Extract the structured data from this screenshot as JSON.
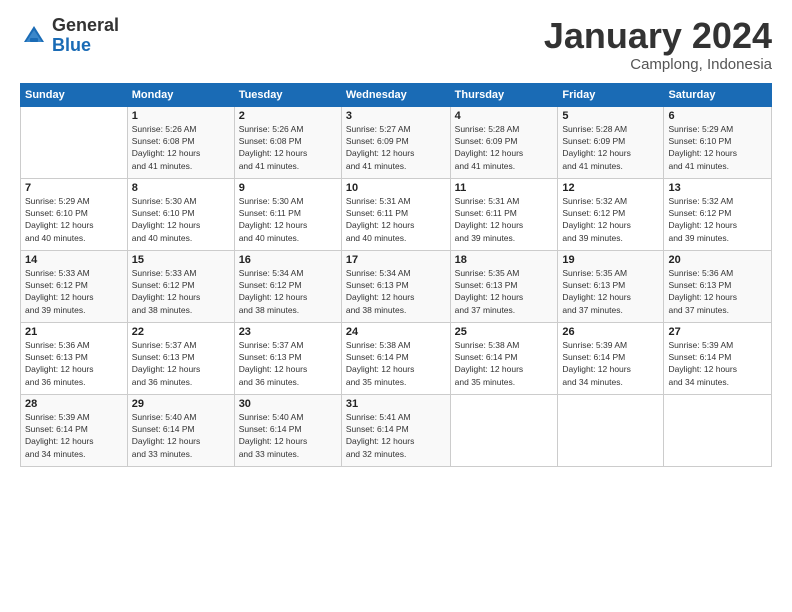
{
  "logo": {
    "general": "General",
    "blue": "Blue"
  },
  "header": {
    "month": "January 2024",
    "location": "Camplong, Indonesia"
  },
  "weekdays": [
    "Sunday",
    "Monday",
    "Tuesday",
    "Wednesday",
    "Thursday",
    "Friday",
    "Saturday"
  ],
  "weeks": [
    [
      {
        "day": "",
        "sunrise": "",
        "sunset": "",
        "daylight": ""
      },
      {
        "day": "1",
        "sunrise": "5:26 AM",
        "sunset": "6:08 PM",
        "daylight": "12 hours and 41 minutes."
      },
      {
        "day": "2",
        "sunrise": "5:26 AM",
        "sunset": "6:08 PM",
        "daylight": "12 hours and 41 minutes."
      },
      {
        "day": "3",
        "sunrise": "5:27 AM",
        "sunset": "6:09 PM",
        "daylight": "12 hours and 41 minutes."
      },
      {
        "day": "4",
        "sunrise": "5:28 AM",
        "sunset": "6:09 PM",
        "daylight": "12 hours and 41 minutes."
      },
      {
        "day": "5",
        "sunrise": "5:28 AM",
        "sunset": "6:09 PM",
        "daylight": "12 hours and 41 minutes."
      },
      {
        "day": "6",
        "sunrise": "5:29 AM",
        "sunset": "6:10 PM",
        "daylight": "12 hours and 41 minutes."
      }
    ],
    [
      {
        "day": "7",
        "sunrise": "5:29 AM",
        "sunset": "6:10 PM",
        "daylight": "12 hours and 40 minutes."
      },
      {
        "day": "8",
        "sunrise": "5:30 AM",
        "sunset": "6:10 PM",
        "daylight": "12 hours and 40 minutes."
      },
      {
        "day": "9",
        "sunrise": "5:30 AM",
        "sunset": "6:11 PM",
        "daylight": "12 hours and 40 minutes."
      },
      {
        "day": "10",
        "sunrise": "5:31 AM",
        "sunset": "6:11 PM",
        "daylight": "12 hours and 40 minutes."
      },
      {
        "day": "11",
        "sunrise": "5:31 AM",
        "sunset": "6:11 PM",
        "daylight": "12 hours and 39 minutes."
      },
      {
        "day": "12",
        "sunrise": "5:32 AM",
        "sunset": "6:12 PM",
        "daylight": "12 hours and 39 minutes."
      },
      {
        "day": "13",
        "sunrise": "5:32 AM",
        "sunset": "6:12 PM",
        "daylight": "12 hours and 39 minutes."
      }
    ],
    [
      {
        "day": "14",
        "sunrise": "5:33 AM",
        "sunset": "6:12 PM",
        "daylight": "12 hours and 39 minutes."
      },
      {
        "day": "15",
        "sunrise": "5:33 AM",
        "sunset": "6:12 PM",
        "daylight": "12 hours and 38 minutes."
      },
      {
        "day": "16",
        "sunrise": "5:34 AM",
        "sunset": "6:12 PM",
        "daylight": "12 hours and 38 minutes."
      },
      {
        "day": "17",
        "sunrise": "5:34 AM",
        "sunset": "6:13 PM",
        "daylight": "12 hours and 38 minutes."
      },
      {
        "day": "18",
        "sunrise": "5:35 AM",
        "sunset": "6:13 PM",
        "daylight": "12 hours and 37 minutes."
      },
      {
        "day": "19",
        "sunrise": "5:35 AM",
        "sunset": "6:13 PM",
        "daylight": "12 hours and 37 minutes."
      },
      {
        "day": "20",
        "sunrise": "5:36 AM",
        "sunset": "6:13 PM",
        "daylight": "12 hours and 37 minutes."
      }
    ],
    [
      {
        "day": "21",
        "sunrise": "5:36 AM",
        "sunset": "6:13 PM",
        "daylight": "12 hours and 36 minutes."
      },
      {
        "day": "22",
        "sunrise": "5:37 AM",
        "sunset": "6:13 PM",
        "daylight": "12 hours and 36 minutes."
      },
      {
        "day": "23",
        "sunrise": "5:37 AM",
        "sunset": "6:13 PM",
        "daylight": "12 hours and 36 minutes."
      },
      {
        "day": "24",
        "sunrise": "5:38 AM",
        "sunset": "6:14 PM",
        "daylight": "12 hours and 35 minutes."
      },
      {
        "day": "25",
        "sunrise": "5:38 AM",
        "sunset": "6:14 PM",
        "daylight": "12 hours and 35 minutes."
      },
      {
        "day": "26",
        "sunrise": "5:39 AM",
        "sunset": "6:14 PM",
        "daylight": "12 hours and 34 minutes."
      },
      {
        "day": "27",
        "sunrise": "5:39 AM",
        "sunset": "6:14 PM",
        "daylight": "12 hours and 34 minutes."
      }
    ],
    [
      {
        "day": "28",
        "sunrise": "5:39 AM",
        "sunset": "6:14 PM",
        "daylight": "12 hours and 34 minutes."
      },
      {
        "day": "29",
        "sunrise": "5:40 AM",
        "sunset": "6:14 PM",
        "daylight": "12 hours and 33 minutes."
      },
      {
        "day": "30",
        "sunrise": "5:40 AM",
        "sunset": "6:14 PM",
        "daylight": "12 hours and 33 minutes."
      },
      {
        "day": "31",
        "sunrise": "5:41 AM",
        "sunset": "6:14 PM",
        "daylight": "12 hours and 32 minutes."
      },
      {
        "day": "",
        "sunrise": "",
        "sunset": "",
        "daylight": ""
      },
      {
        "day": "",
        "sunrise": "",
        "sunset": "",
        "daylight": ""
      },
      {
        "day": "",
        "sunrise": "",
        "sunset": "",
        "daylight": ""
      }
    ]
  ],
  "labels": {
    "sunrise": "Sunrise:",
    "sunset": "Sunset:",
    "daylight": "Daylight:"
  }
}
